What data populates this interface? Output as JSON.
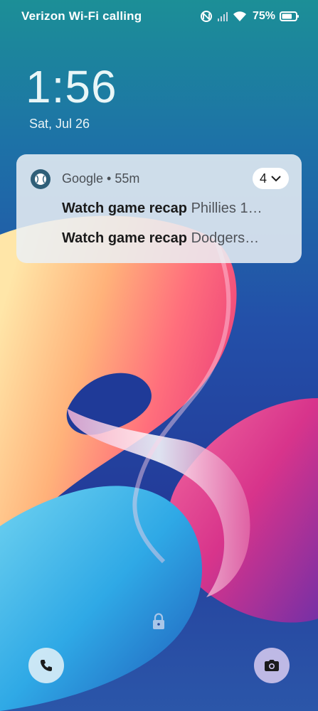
{
  "status_bar": {
    "carrier": "Verizon Wi-Fi calling",
    "battery_percent": "75%",
    "battery_level": 0.75,
    "icons": [
      "nfc-icon",
      "cellular-signal-icon",
      "wifi-icon",
      "battery-icon"
    ]
  },
  "lockscreen": {
    "time": "1:56",
    "date": "Sat, Jul 26"
  },
  "notification": {
    "app_icon": "baseball-icon",
    "header": "Google • 55m",
    "count": "4",
    "expand_icon": "chevron-down-icon",
    "items": [
      {
        "title": "Watch game recap",
        "text": "Phillies 1…"
      },
      {
        "title": "Watch game recap",
        "text": "Dodgers…"
      }
    ]
  },
  "bottom": {
    "lock_icon": "lock-icon",
    "left_shortcut_icon": "phone-icon",
    "right_shortcut_icon": "camera-icon"
  },
  "colors": {
    "notification_bg": "#ebf0f4",
    "phone_button_bg": "#d7ecf6",
    "camera_button_bg": "#cec4ec"
  }
}
